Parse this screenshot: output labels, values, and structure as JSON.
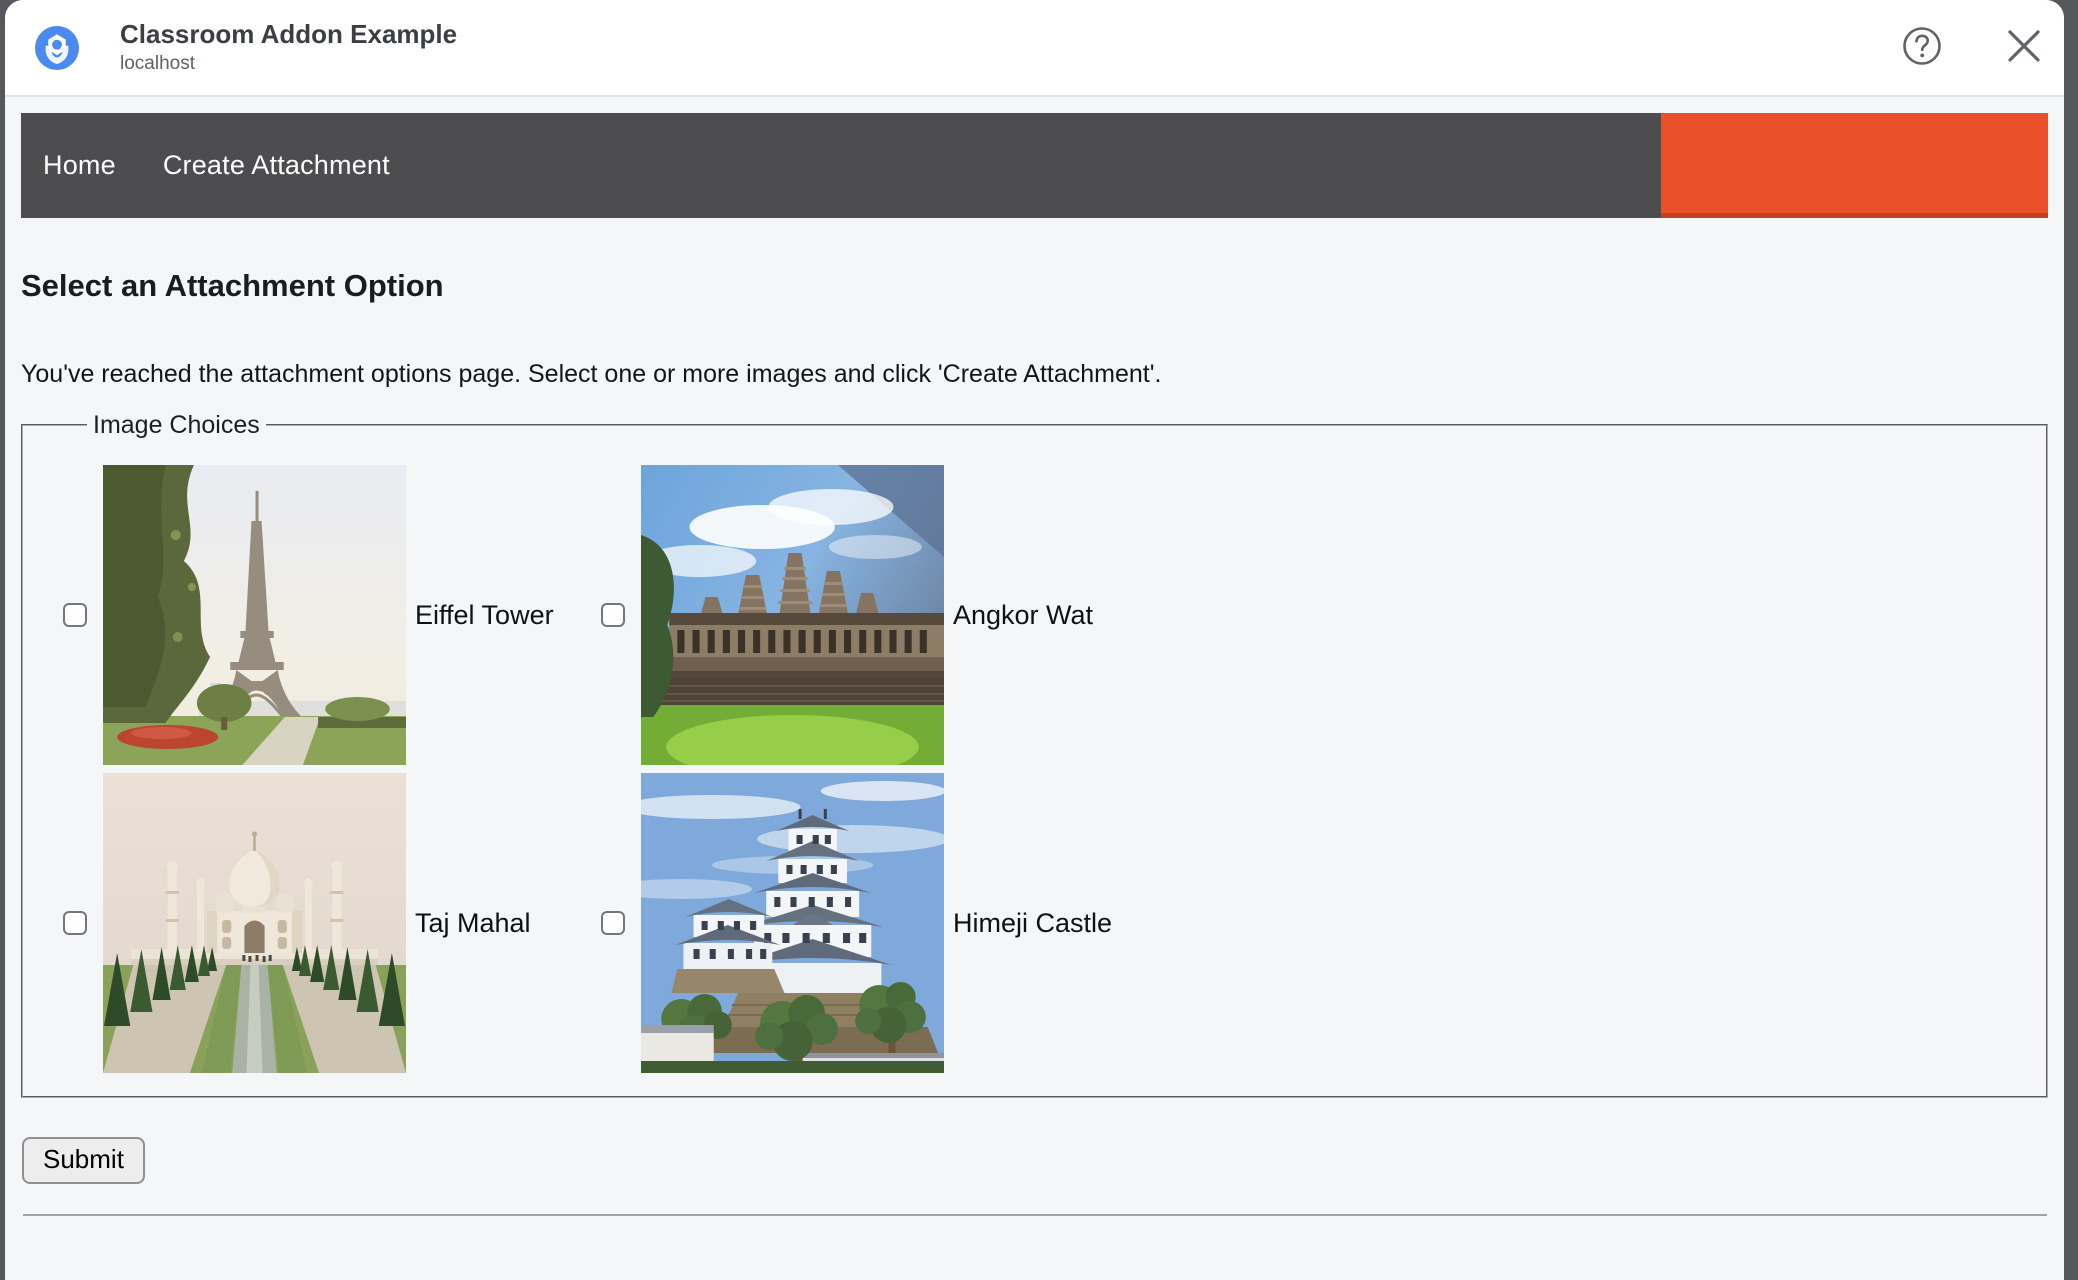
{
  "backdrop_color": "#55575a",
  "dialog": {
    "header": {
      "title": "Classroom Addon Example",
      "subtitle": "localhost",
      "help_icon": "circled-question-mark",
      "close_icon": "x"
    },
    "nav": {
      "items": [
        "Home",
        "Create Attachment"
      ],
      "bar_color": "#4d4d50",
      "accent_color": "#e9512b"
    },
    "content": {
      "heading": "Select an Attachment Option",
      "instructions": "You've reached the attachment options page. Select one or more images and click 'Create Attachment'.",
      "image_choices": {
        "legend": "Image Choices",
        "options": [
          {
            "label": "Eiffel Tower",
            "checked": false,
            "image": "eiffel-tower-photo"
          },
          {
            "label": "Angkor Wat",
            "checked": false,
            "image": "angkor-wat-photo"
          },
          {
            "label": "Taj Mahal",
            "checked": false,
            "image": "taj-mahal-photo"
          },
          {
            "label": "Himeji Castle",
            "checked": false,
            "image": "himeji-castle-photo"
          }
        ]
      },
      "submit_label": "Submit"
    }
  }
}
